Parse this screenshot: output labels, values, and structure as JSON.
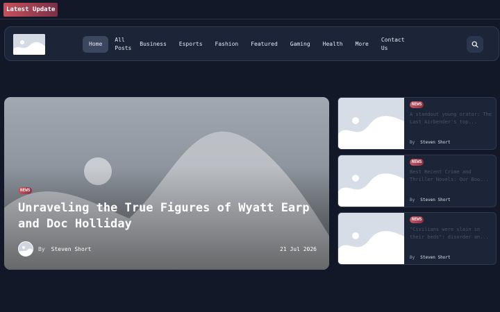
{
  "topbar": {
    "latest_label": "Latest Update"
  },
  "nav": {
    "items": [
      {
        "label": "Home"
      },
      {
        "label": "All Posts"
      },
      {
        "label": "Business"
      },
      {
        "label": "Esports"
      },
      {
        "label": "Fashion"
      },
      {
        "label": "Featured"
      },
      {
        "label": "Gaming"
      },
      {
        "label": "Health"
      },
      {
        "label": "More"
      },
      {
        "label": "Contact Us"
      }
    ],
    "active": "Home",
    "search_icon": "search-icon"
  },
  "hero": {
    "badge": "NEWS",
    "title": "Unraveling the True Figures of Wyatt Earp and Doc Holliday",
    "by": "By",
    "author": "Steven Short",
    "date": "21 Jul 2026"
  },
  "side_posts": [
    {
      "badge": "NEWS",
      "title": "A standout young orator: The Last Airbender's top...",
      "by": "By",
      "author": "Steven Short"
    },
    {
      "badge": "NEWS",
      "title": "Best Recent Crime and Thriller Novels: Our Boo...",
      "by": "By",
      "author": "Steven Short"
    },
    {
      "badge": "NEWS",
      "title": "\"Civilians were slain in their beds\": disorder an...",
      "by": "By",
      "author": "Steven Short"
    }
  ],
  "colors": {
    "background": "#121828",
    "panel": "#1c2538",
    "accent": "#c8505a"
  }
}
